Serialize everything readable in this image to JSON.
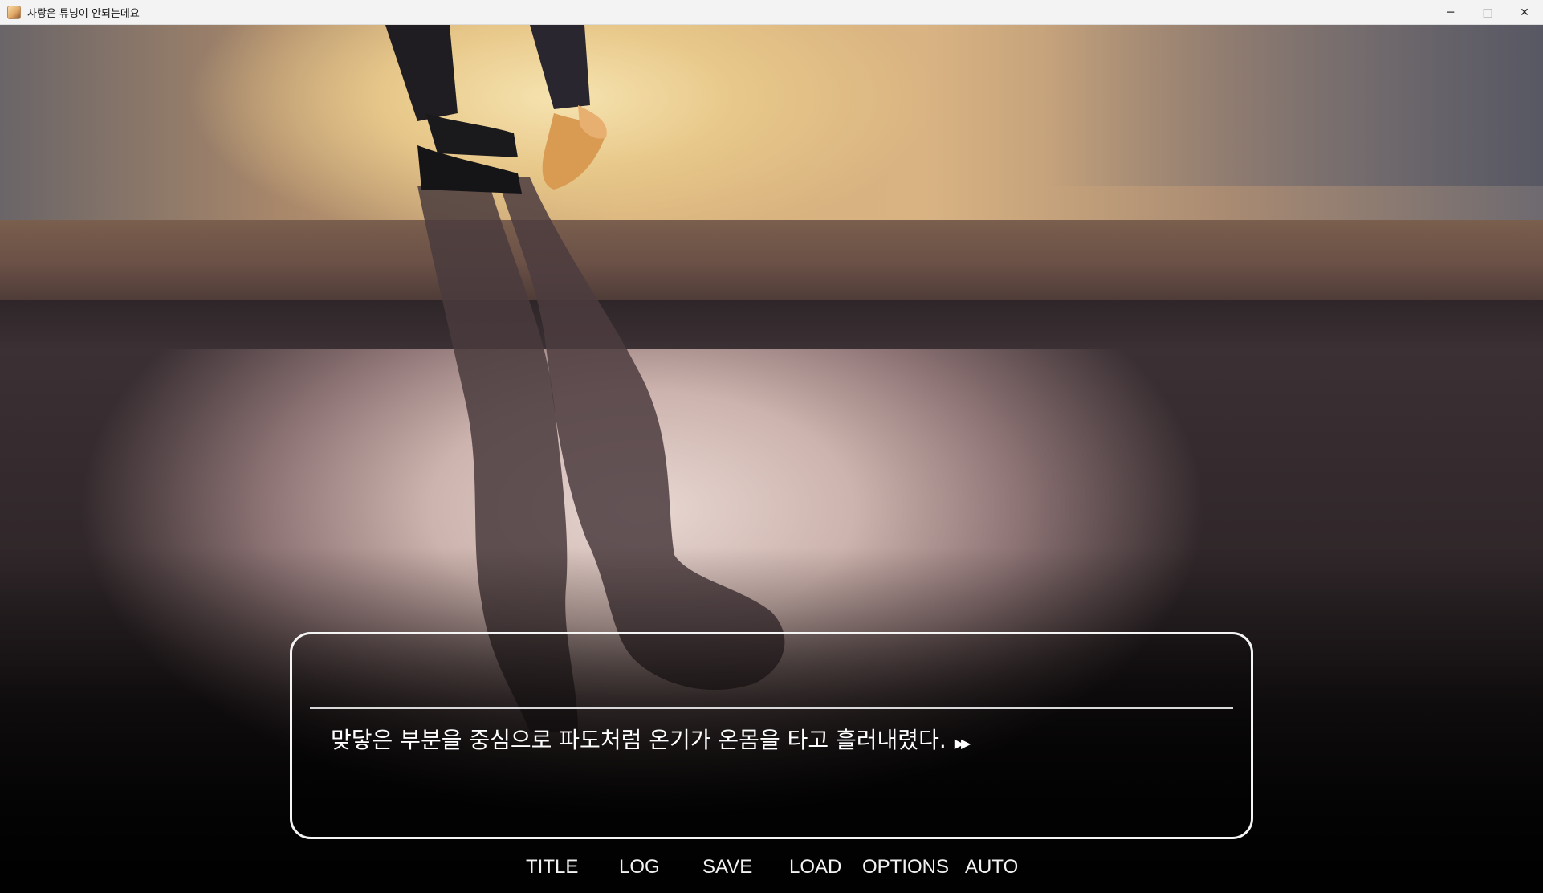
{
  "window": {
    "title": "사랑은 튜닝이 안되는데요",
    "icon": "app-icon",
    "controls": {
      "minimize": "─",
      "maximize": "□",
      "close": "✕"
    }
  },
  "dialogue": {
    "text": "맞닿은 부분을 중심으로 파도처럼 온기가 온몸을 타고 흘러내렸다.",
    "advance_glyph": "▶▶"
  },
  "quick_menu": {
    "title": "TITLE",
    "log": "LOG",
    "save": "SAVE",
    "load": "LOAD",
    "options": "OPTIONS",
    "auto": "AUTO"
  },
  "colors": {
    "menu_text": "#f2f2f2",
    "box_border": "#f4f4f4",
    "sky_glow": "#f6e3b0"
  }
}
